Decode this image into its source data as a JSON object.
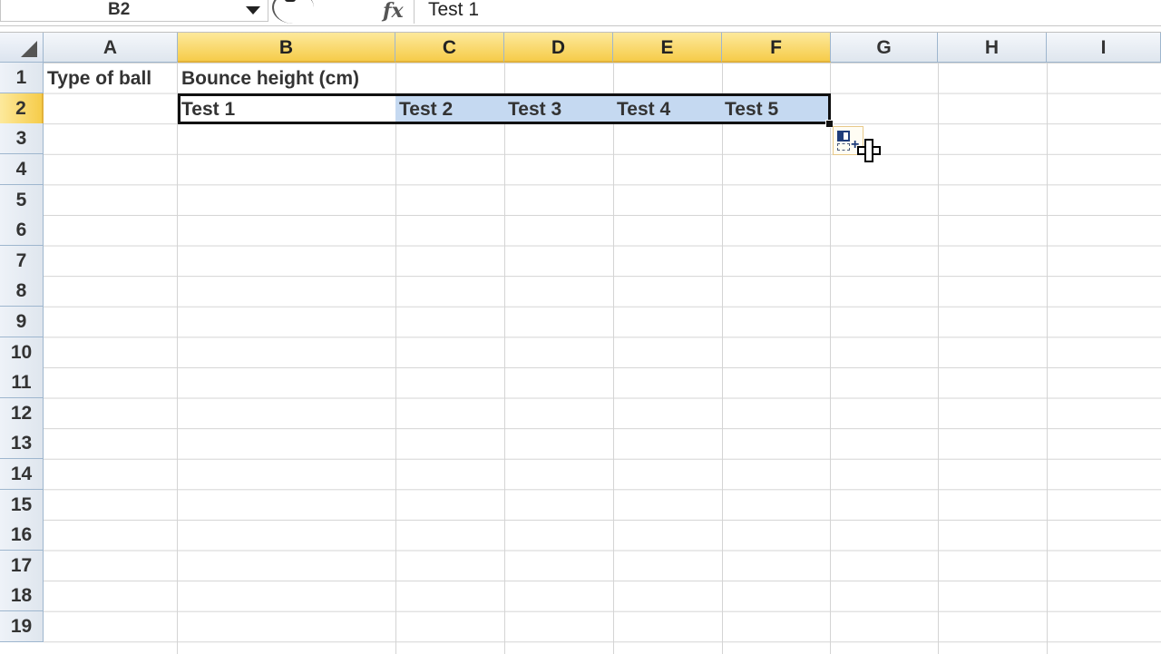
{
  "formula_bar": {
    "name_box": "B2",
    "formula_value": "Test 1",
    "fx_label": "fx"
  },
  "columns": [
    "A",
    "B",
    "C",
    "D",
    "E",
    "F",
    "G",
    "H",
    "I"
  ],
  "active_columns": [
    "B",
    "C",
    "D",
    "E",
    "F"
  ],
  "rows": [
    "1",
    "2",
    "3",
    "4",
    "5",
    "6",
    "7",
    "8",
    "9",
    "10",
    "11",
    "12",
    "13",
    "14",
    "15",
    "16",
    "17",
    "18",
    "19"
  ],
  "active_row": "2",
  "cells": {
    "A1": "Type of ball",
    "B1": "Bounce height (cm)",
    "B2": "Test 1",
    "C2": "Test 2",
    "D2": "Test 3",
    "E2": "Test 4",
    "F2": "Test 5"
  },
  "selection_range": "B2:F2",
  "colors": {
    "selection_fill": "#c5d9f1",
    "active_header": "#f6cc4a",
    "header_border": "#9eb6ce",
    "gridline": "#d4d4d4"
  },
  "icons": {
    "name_box_dropdown": "chevron-down-icon",
    "function": "fx-icon",
    "autofill_options": "auto-fill-options-icon",
    "cursor": "cross-cursor-icon",
    "select_all": "select-all-triangle-icon"
  }
}
